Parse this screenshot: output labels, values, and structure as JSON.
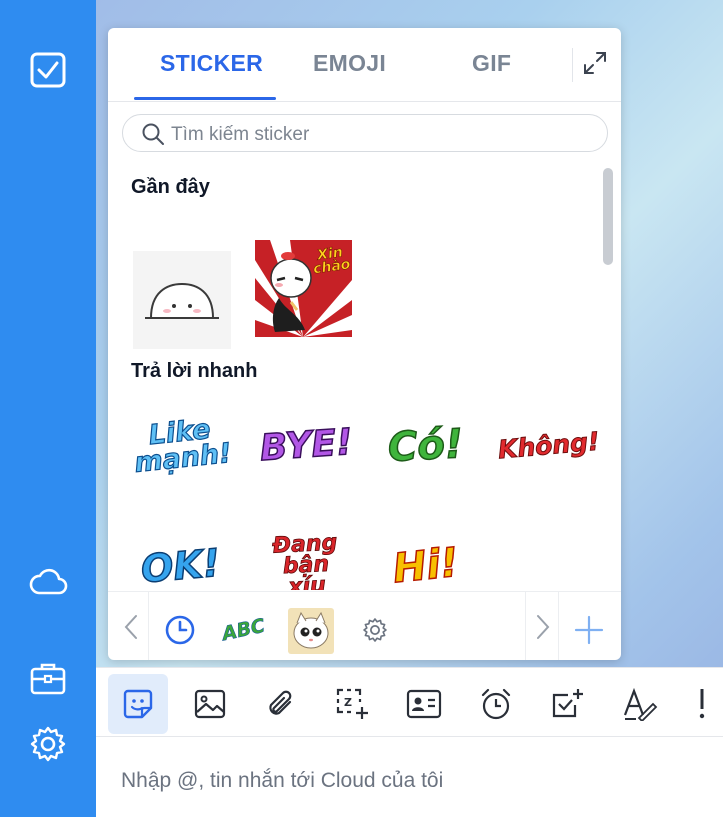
{
  "rail": {
    "items": [
      {
        "icon": "checkbox-icon"
      },
      {
        "icon": "cloud-icon"
      },
      {
        "icon": "briefcase-icon"
      },
      {
        "icon": "gear-icon"
      }
    ]
  },
  "panel": {
    "tabs": [
      {
        "label": "STICKER",
        "active": true
      },
      {
        "label": "EMOJI",
        "active": false
      },
      {
        "label": "GIF",
        "active": false
      }
    ],
    "search_placeholder": "Tìm kiếm sticker",
    "sections": [
      {
        "title": "Gần đây"
      },
      {
        "title": "Trả lời nhanh"
      }
    ],
    "recent_sticker_text": "Xin chào",
    "quick_replies": [
      {
        "text": "Like mạnh!",
        "color": "#39a6f0"
      },
      {
        "text": "BYE!",
        "color": "#b04ce0"
      },
      {
        "text": "Có!",
        "color": "#3cae3a"
      },
      {
        "text": "Không!",
        "color": "#e0262b"
      },
      {
        "text": "OK!",
        "color": "#2d9de8"
      },
      {
        "text": "Đang bận xíu",
        "color": "#d41f24"
      },
      {
        "text": "Hi!",
        "color": "#f7b500"
      }
    ],
    "footer_pack_text": "ABC"
  },
  "composer": {
    "placeholder": "Nhập @, tin nhắn tới Cloud của tôi"
  },
  "colors": {
    "rail": "#2f8cf0",
    "accent": "#2b67e8"
  }
}
